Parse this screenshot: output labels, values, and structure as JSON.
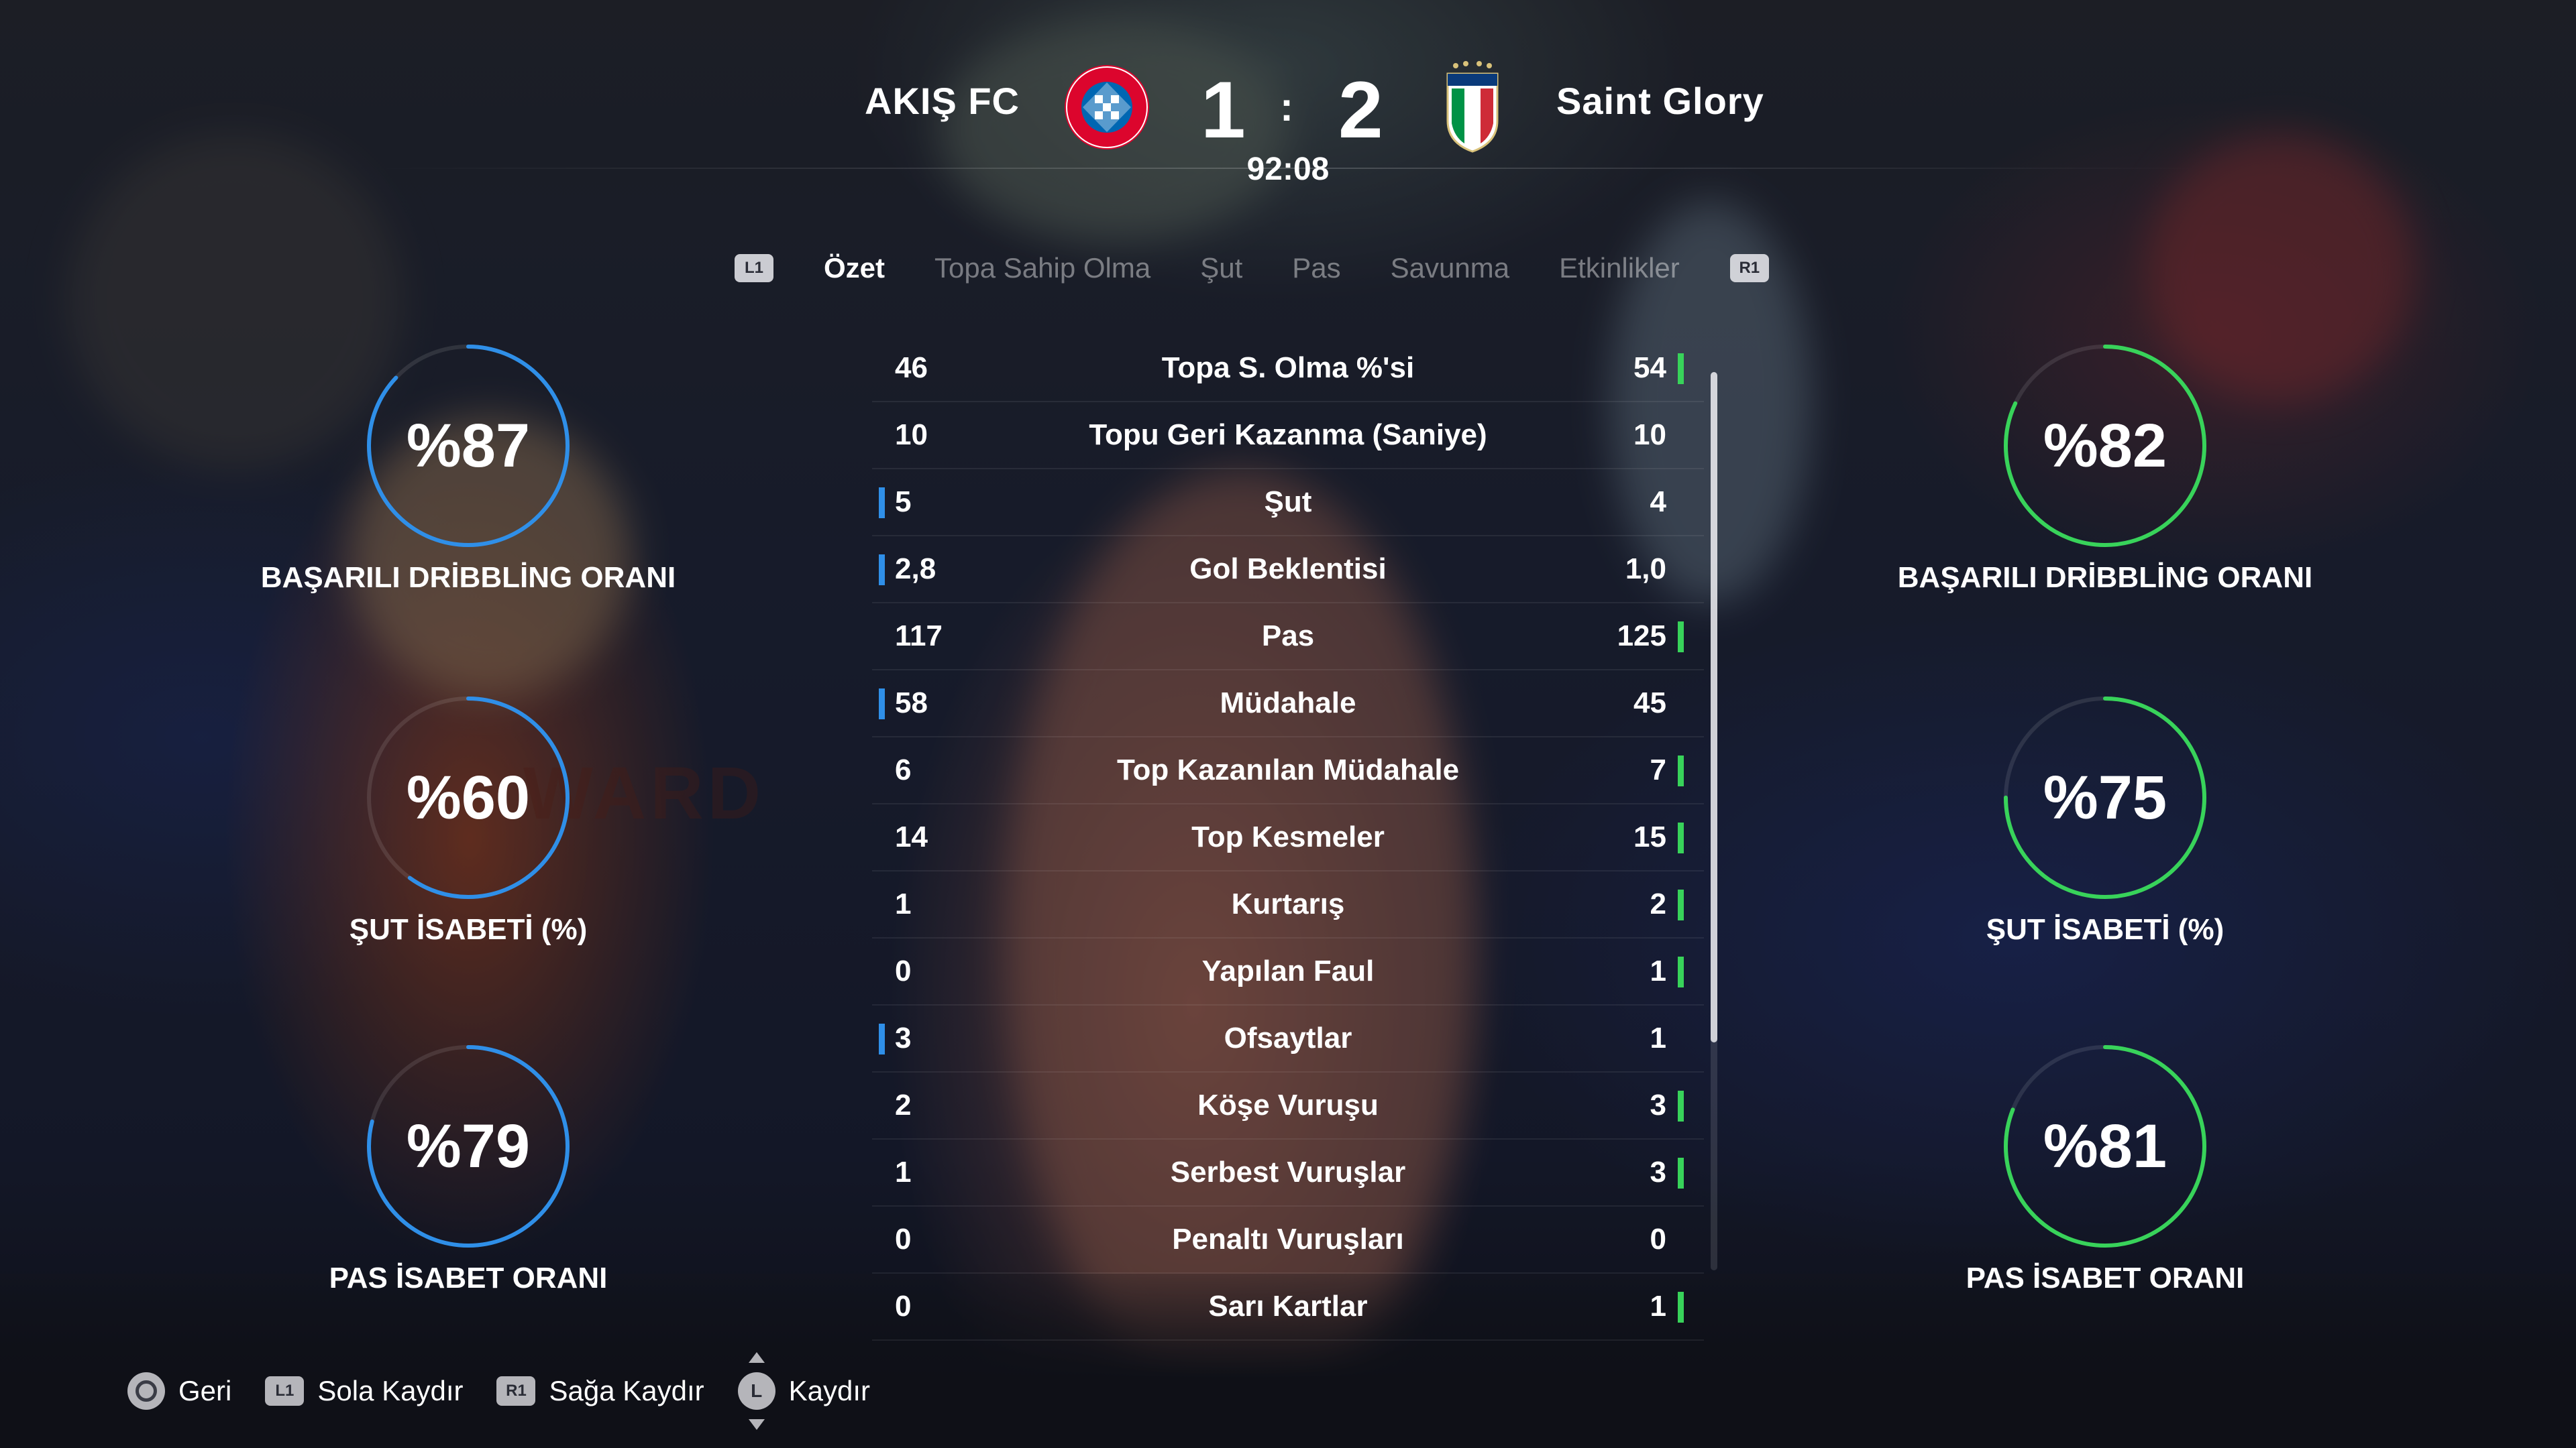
{
  "match": {
    "home_team": "AKIŞ FC",
    "away_team": "Saint Glory",
    "home_score": "1",
    "separator": ":",
    "away_score": "2",
    "clock": "92:08",
    "home_crest_text": "FC BAYERN MÜNCHEN",
    "away_crest_text": "ITALIA"
  },
  "tabs": {
    "left_button": "L1",
    "right_button": "R1",
    "items": [
      "Özet",
      "Topa Sahip Olma",
      "Şut",
      "Pas",
      "Savunma",
      "Etkinlikler"
    ],
    "active": "Özet"
  },
  "stats": [
    {
      "label": "Topa S. Olma %'si",
      "home": "46",
      "away": "54",
      "leader": "away"
    },
    {
      "label": "Topu Geri Kazanma (Saniye)",
      "home": "10",
      "away": "10",
      "leader": "none"
    },
    {
      "label": "Şut",
      "home": "5",
      "away": "4",
      "leader": "home"
    },
    {
      "label": "Gol Beklentisi",
      "home": "2,8",
      "away": "1,0",
      "leader": "home"
    },
    {
      "label": "Pas",
      "home": "117",
      "away": "125",
      "leader": "away"
    },
    {
      "label": "Müdahale",
      "home": "58",
      "away": "45",
      "leader": "home"
    },
    {
      "label": "Top Kazanılan Müdahale",
      "home": "6",
      "away": "7",
      "leader": "away"
    },
    {
      "label": "Top Kesmeler",
      "home": "14",
      "away": "15",
      "leader": "away"
    },
    {
      "label": "Kurtarış",
      "home": "1",
      "away": "2",
      "leader": "away"
    },
    {
      "label": "Yapılan Faul",
      "home": "0",
      "away": "1",
      "leader": "away"
    },
    {
      "label": "Ofsaytlar",
      "home": "3",
      "away": "1",
      "leader": "home"
    },
    {
      "label": "Köşe Vuruşu",
      "home": "2",
      "away": "3",
      "leader": "away"
    },
    {
      "label": "Serbest Vuruşlar",
      "home": "1",
      "away": "3",
      "leader": "away"
    },
    {
      "label": "Penaltı Vuruşları",
      "home": "0",
      "away": "0",
      "leader": "none"
    },
    {
      "label": "Sarı Kartlar",
      "home": "0",
      "away": "1",
      "leader": "away"
    }
  ],
  "home_rings": [
    {
      "value": "%87",
      "percent": 87,
      "label": "BAŞARILI DRİBBLİNG ORANI"
    },
    {
      "value": "%60",
      "percent": 60,
      "label": "ŞUT İSABETİ (%)"
    },
    {
      "value": "%79",
      "percent": 79,
      "label": "PAS İSABET ORANI"
    }
  ],
  "away_rings": [
    {
      "value": "%82",
      "percent": 82,
      "label": "BAŞARILI DRİBBLİNG ORANI"
    },
    {
      "value": "%75",
      "percent": 75,
      "label": "ŞUT İSABETİ (%)"
    },
    {
      "value": "%81",
      "percent": 81,
      "label": "PAS İSABET ORANI"
    }
  ],
  "colors": {
    "home_accent": "#2f8fe8",
    "away_accent": "#38d35a"
  },
  "footer": {
    "back": "Geri",
    "l1_label": "L1",
    "l1_action": "Sola Kaydır",
    "r1_label": "R1",
    "r1_action": "Sağa Kaydır",
    "stick_label": "L",
    "stick_action": "Kaydır"
  }
}
